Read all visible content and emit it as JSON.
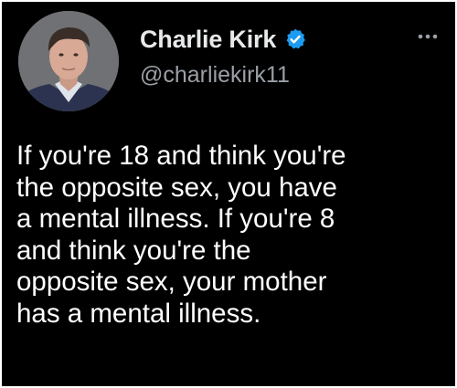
{
  "tweet": {
    "author": {
      "display_name": "Charlie Kirk",
      "handle": "@charliekirk11",
      "verified": true
    },
    "text": "If you're 18 and think you're\nthe opposite sex, you have\na mental illness. If you're 8\nand think you're the\nopposite sex, your mother\nhas a mental illness."
  },
  "icons": {
    "verified": "verified-badge-icon",
    "more": "more-options-icon"
  },
  "colors": {
    "background": "#000000",
    "text": "#ffffff",
    "secondary_text": "#9aa0a6",
    "verified_badge": "#1d9bf0",
    "border": "#ffffff"
  }
}
